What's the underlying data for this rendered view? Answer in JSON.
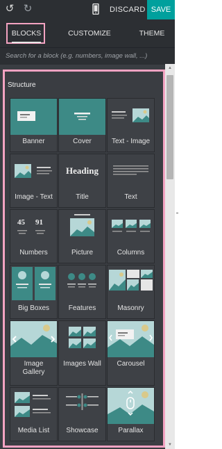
{
  "topbar": {
    "undo_icon": "undo-icon",
    "redo_icon": "redo-icon",
    "mobile_icon": "mobile-preview-icon",
    "discard_label": "DISCARD",
    "save_label": "SAVE",
    "save_color": "#00a09d"
  },
  "tabs": [
    {
      "label": "BLOCKS",
      "active": true
    },
    {
      "label": "CUSTOMIZE",
      "active": false
    },
    {
      "label": "THEME",
      "active": false
    }
  ],
  "search": {
    "placeholder": "Search for a block (e.g. numbers, image wall, ...)",
    "value": ""
  },
  "section": {
    "title": "Structure"
  },
  "blocks": [
    {
      "label": "Banner"
    },
    {
      "label": "Cover"
    },
    {
      "label": "Text - Image"
    },
    {
      "label": "Image - Text"
    },
    {
      "label": "Title",
      "thumb_text": "Heading"
    },
    {
      "label": "Text"
    },
    {
      "label": "Numbers",
      "thumb_text": [
        "45",
        "91"
      ]
    },
    {
      "label": "Picture"
    },
    {
      "label": "Columns"
    },
    {
      "label": "Big Boxes"
    },
    {
      "label": "Features"
    },
    {
      "label": "Masonry"
    },
    {
      "label": "Image Gallery"
    },
    {
      "label": "Images Wall"
    },
    {
      "label": "Carousel"
    },
    {
      "label": "Media List"
    },
    {
      "label": "Showcase"
    },
    {
      "label": "Parallax"
    }
  ],
  "colors": {
    "highlight": "#f3a3c2",
    "panel_bg": "#3a3d42",
    "topbar_bg": "#2c2f33",
    "teal": "#3d8a86",
    "sky": "#b6d7d7"
  }
}
